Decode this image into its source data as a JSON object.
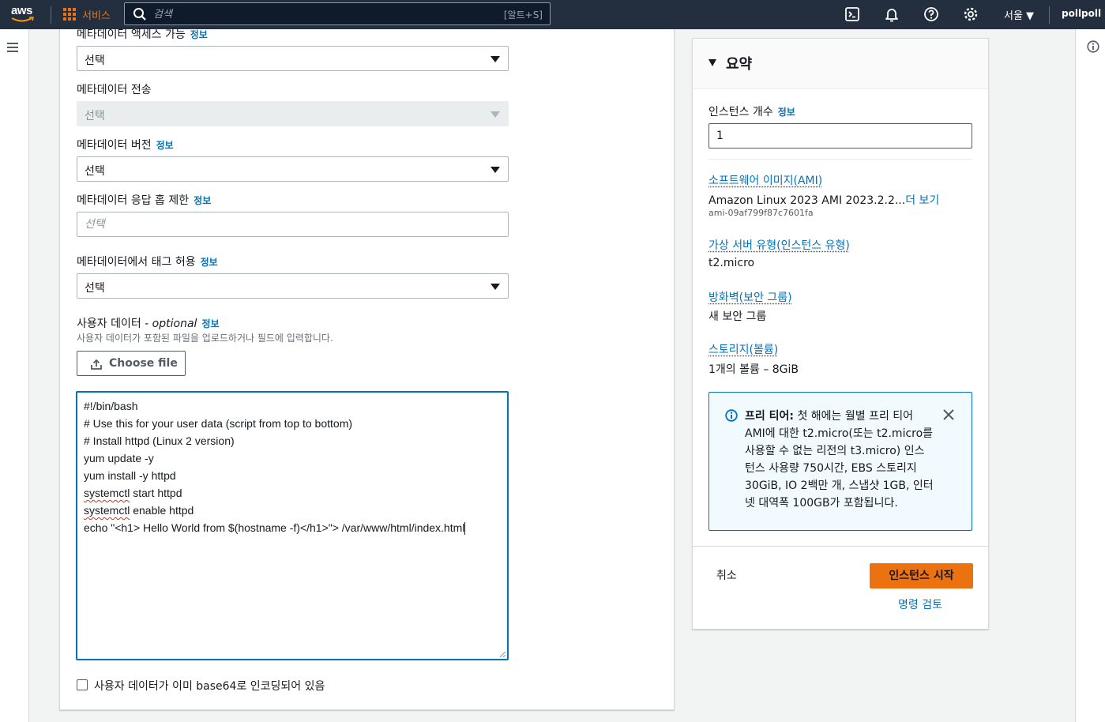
{
  "topnav": {
    "logo_text": "aws",
    "services_label": "서비스",
    "search_placeholder": "검색",
    "search_shortcut": "[알트+S]",
    "region_label": "서울 ▼",
    "user_label": "pollpoll"
  },
  "form": {
    "metadata_access": {
      "label": "메타데이터 액세스 가능",
      "info": "정보",
      "value": "선택"
    },
    "metadata_transport": {
      "label": "메타데이터 전송",
      "value": "선택"
    },
    "metadata_version": {
      "label": "메타데이터 버전",
      "info": "정보",
      "value": "선택"
    },
    "metadata_hop_limit": {
      "label": "메타데이터 응답 홉 제한",
      "info": "정보",
      "placeholder": "선택"
    },
    "metadata_tags": {
      "label": "메타데이터에서 태그 허용",
      "info": "정보",
      "value": "선택"
    },
    "user_data": {
      "label": "사용자 데이터",
      "optional": " - optional",
      "info": "정보",
      "description": "사용자 데이터가 포함된 파일을 업로드하거나 필드에 입력합니다.",
      "choose_file": "Choose file",
      "lines": [
        "#!/bin/bash",
        "# Use this for your user data (script from top to bottom)",
        "# Install httpd (Linux 2 version)",
        "yum update -y",
        "yum install -y httpd",
        "systemctl start httpd",
        "systemctl enable httpd",
        "echo \"<h1> Hello World from $(hostname -f)</h1>\"> /var/www/html/index.html"
      ]
    },
    "base64_checkbox": "사용자 데이터가 이미 base64로 인코딩되어 있음"
  },
  "summary": {
    "title": "요약",
    "instance_count_label": "인스턴스 개수",
    "instance_count_info": "정보",
    "instance_count_value": "1",
    "ami_link": "소프트웨어 이미지(AMI)",
    "ami_value": "Amazon Linux 2023 AMI 2023.2.2...",
    "ami_more": "더 보기",
    "ami_id": "ami-09af799f87c7601fa",
    "instance_type_link": "가상 서버 유형(인스턴스 유형)",
    "instance_type_value": "t2.micro",
    "firewall_link": "방화벽(보안 그룹)",
    "firewall_value": "새 보안 그룹",
    "storage_link": "스토리지(볼륨)",
    "storage_value": "1개의 볼륨 – 8GiB",
    "free_tier_title": "프리 티어:",
    "free_tier_text": " 첫 해에는 월별 프리 티어 AMI에 대한 t2.micro(또는 t2.micro를 사용할 수 없는 리전의 t3.micro) 인스턴스 사용량 750시간, EBS 스토리지 30GiB, IO 2백만 개, 스냅샷 1GB, 인터넷 대역폭 100GB가 포함됩니다.",
    "cancel": "취소",
    "launch": "인스턴스 시작",
    "review_commands": "명령 검토"
  },
  "colors": {
    "nav_bg": "#232f3e",
    "accent_orange": "#ec7211",
    "link_blue": "#0073bb"
  }
}
